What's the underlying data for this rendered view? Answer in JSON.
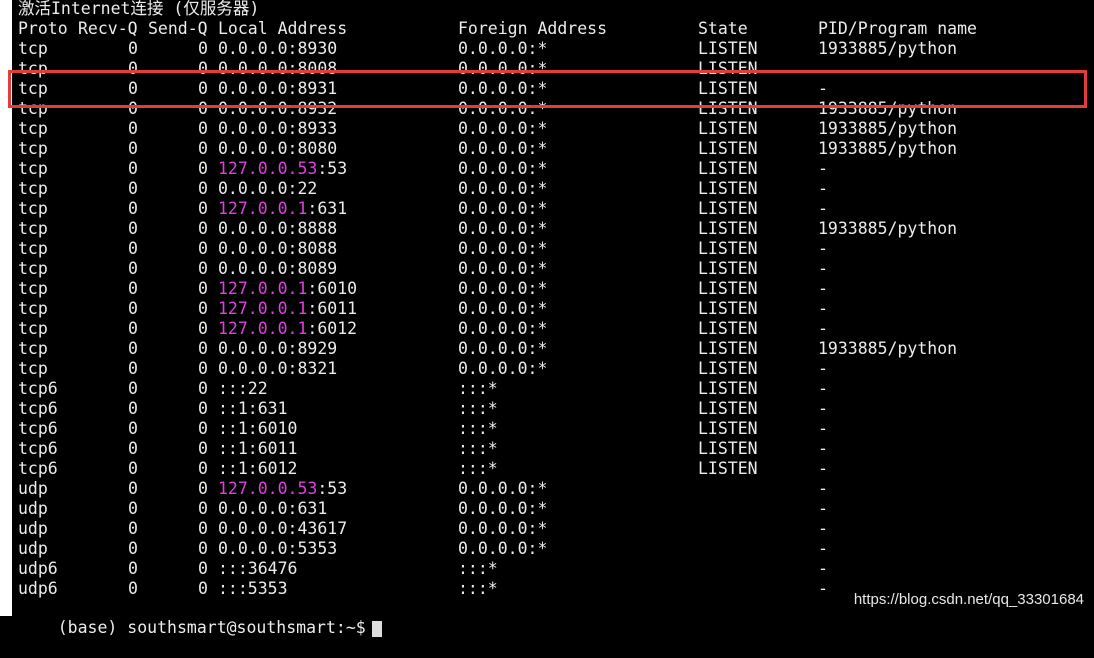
{
  "terminal": {
    "title": "激活Internet连接 (仅服务器)",
    "header": {
      "proto": "Proto",
      "recv": "Recv-Q",
      "send": "Send-Q",
      "local": "Local Address",
      "foreign": "Foreign Address",
      "state": "State",
      "pid": "PID/Program name"
    },
    "rows": [
      {
        "proto": "tcp",
        "recv": "0",
        "send": "0",
        "local_ip": "0.0.0.0",
        "local_port": ":8930",
        "foreign": "0.0.0.0:*",
        "state": "LISTEN",
        "pid": "1933885/python"
      },
      {
        "proto": "tcp",
        "recv": "0",
        "send": "0",
        "local_ip": "0.0.0.0",
        "local_port": ":8008",
        "foreign": "0.0.0.0:*",
        "state": "LISTEN",
        "pid": ""
      },
      {
        "proto": "tcp",
        "recv": "0",
        "send": "0",
        "local_ip": "0.0.0.0",
        "local_port": ":8931",
        "foreign": "0.0.0.0:*",
        "state": "LISTEN",
        "pid": "-"
      },
      {
        "proto": "tcp",
        "recv": "0",
        "send": "0",
        "local_ip": "0.0.0.0",
        "local_port": ":8932",
        "foreign": "0.0.0.0:*",
        "state": "LISTEN",
        "pid": "1933885/python"
      },
      {
        "proto": "tcp",
        "recv": "0",
        "send": "0",
        "local_ip": "0.0.0.0",
        "local_port": ":8933",
        "foreign": "0.0.0.0:*",
        "state": "LISTEN",
        "pid": "1933885/python"
      },
      {
        "proto": "tcp",
        "recv": "0",
        "send": "0",
        "local_ip": "0.0.0.0",
        "local_port": ":8080",
        "foreign": "0.0.0.0:*",
        "state": "LISTEN",
        "pid": "1933885/python"
      },
      {
        "proto": "tcp",
        "recv": "0",
        "send": "0",
        "local_ip": "127.0.0.53",
        "local_port": ":53",
        "foreign": "0.0.0.0:*",
        "state": "LISTEN",
        "pid": "-",
        "ip_highlight": true
      },
      {
        "proto": "tcp",
        "recv": "0",
        "send": "0",
        "local_ip": "0.0.0.0",
        "local_port": ":22",
        "foreign": "0.0.0.0:*",
        "state": "LISTEN",
        "pid": "-"
      },
      {
        "proto": "tcp",
        "recv": "0",
        "send": "0",
        "local_ip": "127.0.0.1",
        "local_port": ":631",
        "foreign": "0.0.0.0:*",
        "state": "LISTEN",
        "pid": "-",
        "ip_highlight": true
      },
      {
        "proto": "tcp",
        "recv": "0",
        "send": "0",
        "local_ip": "0.0.0.0",
        "local_port": ":8888",
        "foreign": "0.0.0.0:*",
        "state": "LISTEN",
        "pid": "1933885/python"
      },
      {
        "proto": "tcp",
        "recv": "0",
        "send": "0",
        "local_ip": "0.0.0.0",
        "local_port": ":8088",
        "foreign": "0.0.0.0:*",
        "state": "LISTEN",
        "pid": "-"
      },
      {
        "proto": "tcp",
        "recv": "0",
        "send": "0",
        "local_ip": "0.0.0.0",
        "local_port": ":8089",
        "foreign": "0.0.0.0:*",
        "state": "LISTEN",
        "pid": "-"
      },
      {
        "proto": "tcp",
        "recv": "0",
        "send": "0",
        "local_ip": "127.0.0.1",
        "local_port": ":6010",
        "foreign": "0.0.0.0:*",
        "state": "LISTEN",
        "pid": "-",
        "ip_highlight": true
      },
      {
        "proto": "tcp",
        "recv": "0",
        "send": "0",
        "local_ip": "127.0.0.1",
        "local_port": ":6011",
        "foreign": "0.0.0.0:*",
        "state": "LISTEN",
        "pid": "-",
        "ip_highlight": true
      },
      {
        "proto": "tcp",
        "recv": "0",
        "send": "0",
        "local_ip": "127.0.0.1",
        "local_port": ":6012",
        "foreign": "0.0.0.0:*",
        "state": "LISTEN",
        "pid": "-",
        "ip_highlight": true
      },
      {
        "proto": "tcp",
        "recv": "0",
        "send": "0",
        "local_ip": "0.0.0.0",
        "local_port": ":8929",
        "foreign": "0.0.0.0:*",
        "state": "LISTEN",
        "pid": "1933885/python"
      },
      {
        "proto": "tcp",
        "recv": "0",
        "send": "0",
        "local_ip": "0.0.0.0",
        "local_port": ":8321",
        "foreign": "0.0.0.0:*",
        "state": "LISTEN",
        "pid": "-"
      },
      {
        "proto": "tcp6",
        "recv": "0",
        "send": "0",
        "local_ip": "",
        "local_port": ":::22",
        "foreign": ":::*",
        "state": "LISTEN",
        "pid": "-"
      },
      {
        "proto": "tcp6",
        "recv": "0",
        "send": "0",
        "local_ip": "",
        "local_port": "::1:631",
        "foreign": ":::*",
        "state": "LISTEN",
        "pid": "-"
      },
      {
        "proto": "tcp6",
        "recv": "0",
        "send": "0",
        "local_ip": "",
        "local_port": "::1:6010",
        "foreign": ":::*",
        "state": "LISTEN",
        "pid": "-"
      },
      {
        "proto": "tcp6",
        "recv": "0",
        "send": "0",
        "local_ip": "",
        "local_port": "::1:6011",
        "foreign": ":::*",
        "state": "LISTEN",
        "pid": "-"
      },
      {
        "proto": "tcp6",
        "recv": "0",
        "send": "0",
        "local_ip": "",
        "local_port": "::1:6012",
        "foreign": ":::*",
        "state": "LISTEN",
        "pid": "-"
      },
      {
        "proto": "udp",
        "recv": "0",
        "send": "0",
        "local_ip": "127.0.0.53",
        "local_port": ":53",
        "foreign": "0.0.0.0:*",
        "state": "",
        "pid": "-",
        "ip_highlight": true
      },
      {
        "proto": "udp",
        "recv": "0",
        "send": "0",
        "local_ip": "0.0.0.0",
        "local_port": ":631",
        "foreign": "0.0.0.0:*",
        "state": "",
        "pid": "-"
      },
      {
        "proto": "udp",
        "recv": "0",
        "send": "0",
        "local_ip": "0.0.0.0",
        "local_port": ":43617",
        "foreign": "0.0.0.0:*",
        "state": "",
        "pid": "-"
      },
      {
        "proto": "udp",
        "recv": "0",
        "send": "0",
        "local_ip": "0.0.0.0",
        "local_port": ":5353",
        "foreign": "0.0.0.0:*",
        "state": "",
        "pid": "-"
      },
      {
        "proto": "udp6",
        "recv": "0",
        "send": "0",
        "local_ip": "",
        "local_port": ":::36476",
        "foreign": ":::*",
        "state": "",
        "pid": "-"
      },
      {
        "proto": "udp6",
        "recv": "0",
        "send": "0",
        "local_ip": "",
        "local_port": ":::5353",
        "foreign": ":::*",
        "state": "",
        "pid": "-"
      }
    ],
    "prompt": "(base) southsmart@southsmart:~$"
  },
  "watermark": "https://blog.csdn.net/qq_33301684",
  "colors": {
    "background": "#000000",
    "text": "#ececec",
    "ip_highlight": "#e040e0",
    "annotation_box": "#e63b3b"
  }
}
